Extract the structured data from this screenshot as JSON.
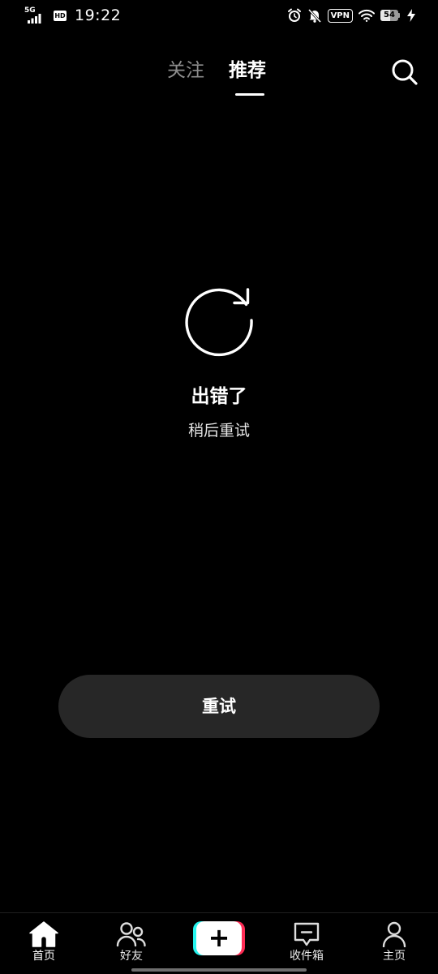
{
  "status_bar": {
    "network": "5G",
    "hd": "HD",
    "time": "19:22",
    "vpn": "VPN",
    "battery_level": "54",
    "battery_fraction": 0.54,
    "icons": [
      "signal-icon",
      "alarm-icon",
      "mute-icon",
      "wifi-icon",
      "charging-icon"
    ]
  },
  "top_tabs": {
    "following": "关注",
    "recommend": "推荐",
    "active": "recommend",
    "search_icon": "search-icon"
  },
  "error": {
    "icon": "refresh-icon",
    "title": "出错了",
    "subtitle": "稍后重试",
    "retry_label": "重试"
  },
  "bottom_nav": {
    "items": [
      {
        "label": "首页",
        "icon": "home-icon",
        "active": true
      },
      {
        "label": "好友",
        "icon": "friends-icon",
        "active": false
      },
      {
        "label": "",
        "icon": "plus-icon",
        "active": false
      },
      {
        "label": "收件箱",
        "icon": "inbox-icon",
        "active": false
      },
      {
        "label": "主页",
        "icon": "profile-icon",
        "active": false
      }
    ]
  },
  "colors": {
    "background": "#000000",
    "inactive_tab": "#8d8d8d",
    "button_bg": "#272727",
    "brand_cyan": "#25f4ee",
    "brand_red": "#fe2c55"
  }
}
